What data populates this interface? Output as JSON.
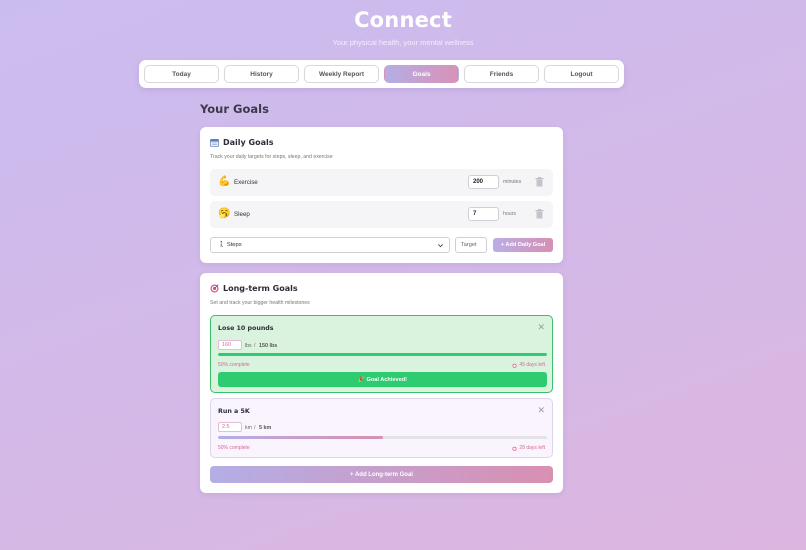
{
  "app": {
    "title": "Connect",
    "subtitle": "Your physical health, your mental wellness"
  },
  "nav": {
    "items": [
      {
        "label": "Today",
        "active": false
      },
      {
        "label": "History",
        "active": false
      },
      {
        "label": "Weekly Report",
        "active": false
      },
      {
        "label": "Goals",
        "active": true
      },
      {
        "label": "Friends",
        "active": false
      },
      {
        "label": "Logout",
        "active": false
      }
    ]
  },
  "page": {
    "title": "Your Goals"
  },
  "daily": {
    "icon": "calendar-icon",
    "title": "Daily Goals",
    "description": "Track your daily targets for steps, sleep, and exercise",
    "goals": [
      {
        "icon": "flexed-bicep-icon",
        "label": "Exercise",
        "value": "200",
        "unit": "minutes"
      },
      {
        "icon": "sleeping-face-icon",
        "label": "Sleep",
        "value": "7",
        "unit": "hours"
      }
    ],
    "add": {
      "select_value": "🚶 Steps",
      "target_placeholder": "Target",
      "button_label": "+ Add Daily Goal"
    }
  },
  "longterm": {
    "icon": "target-icon",
    "title": "Long-term Goals",
    "description": "Set and track your bigger health milestones",
    "goals": [
      {
        "title": "Lose 10 pounds",
        "current": "160",
        "unit": "lbs",
        "separator": "/",
        "target": "150 lbs",
        "progress": 1.0,
        "complete_text": "50% complete",
        "days_text": "45 days left",
        "achieved_label": "🎉 Goal Achieved!",
        "status": "achieved"
      },
      {
        "title": "Run a 5K",
        "current": "2.5",
        "unit": "km",
        "separator": "/",
        "target": "5 km",
        "progress": 0.5,
        "complete_text": "50% complete",
        "days_text": "28 days left",
        "status": "in-progress"
      }
    ],
    "add_button_label": "+ Add Long-term Goal"
  },
  "colors": {
    "accent_start": "#b4aee6",
    "accent_end": "#d992b5",
    "success": "#2ecc70",
    "success_border": "#3dbe68",
    "pink_text": "#d46a96"
  }
}
